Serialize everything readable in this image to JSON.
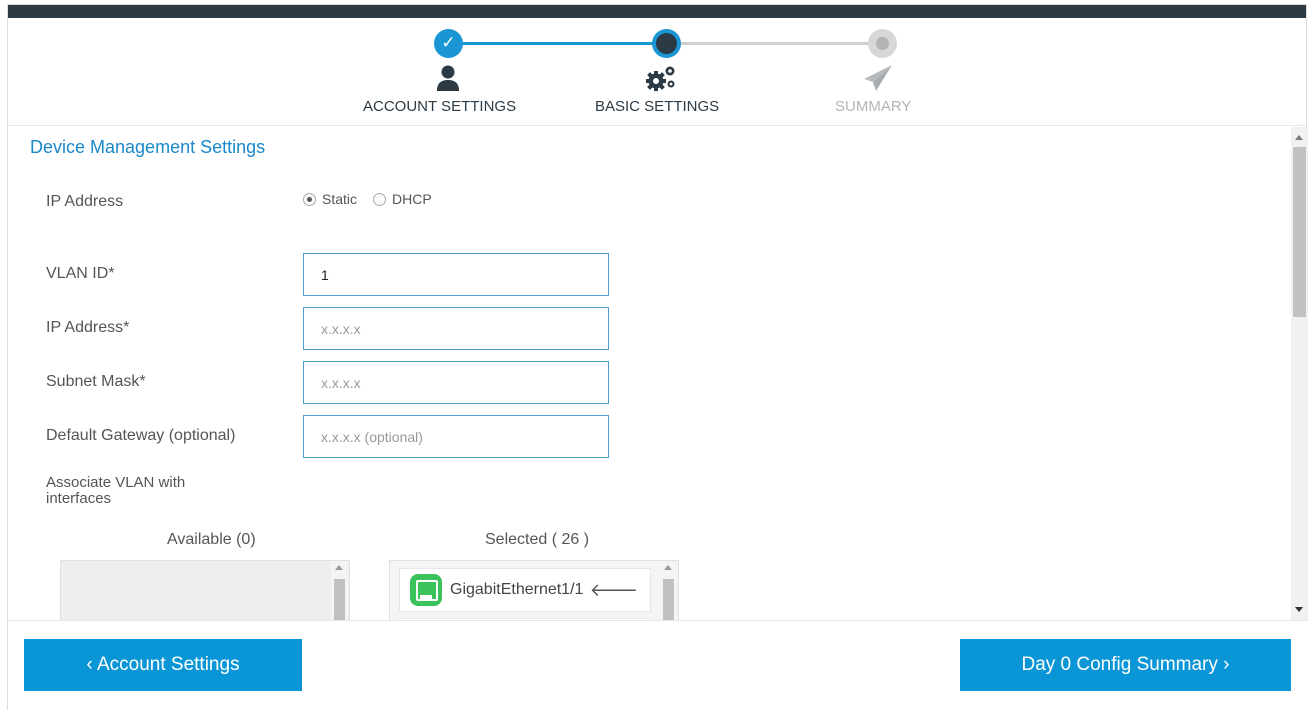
{
  "wizard": {
    "steps": [
      {
        "label": "ACCOUNT SETTINGS",
        "state": "done",
        "icon": "user-icon"
      },
      {
        "label": "BASIC SETTINGS",
        "state": "current",
        "icon": "gears-icon"
      },
      {
        "label": "SUMMARY",
        "state": "pending",
        "icon": "paper-plane-icon"
      }
    ],
    "done_mark": "✓"
  },
  "section": {
    "title": "Device Management Settings"
  },
  "ip_mode": {
    "label": "IP Address",
    "options": [
      {
        "label": "Static",
        "selected": true
      },
      {
        "label": "DHCP",
        "selected": false
      }
    ]
  },
  "fields": {
    "vlan_id": {
      "label": "VLAN ID*",
      "value": "1",
      "placeholder": ""
    },
    "ip_address": {
      "label": "IP Address*",
      "value": "",
      "placeholder": "x.x.x.x"
    },
    "subnet_mask": {
      "label": "Subnet Mask*",
      "value": "",
      "placeholder": "x.x.x.x"
    },
    "default_gateway": {
      "label": "Default Gateway (optional)",
      "value": "",
      "placeholder": "x.x.x.x (optional)"
    }
  },
  "associate": {
    "label": "Associate VLAN with interfaces",
    "available_header": "Available (0)",
    "selected_header": "Selected ( 26 )",
    "selected_items": [
      {
        "name": "GigabitEthernet1/1",
        "icon": "ethernet-port-icon",
        "action_icon": "arrow-left-icon"
      }
    ]
  },
  "footer": {
    "prev_label": "‹ Account Settings",
    "next_label": "Day 0 Config Summary ›"
  },
  "colors": {
    "accent": "#0a96d6",
    "header_bar": "#2b3a45",
    "title": "#1a88c9",
    "port_green": "#3cc25a"
  }
}
